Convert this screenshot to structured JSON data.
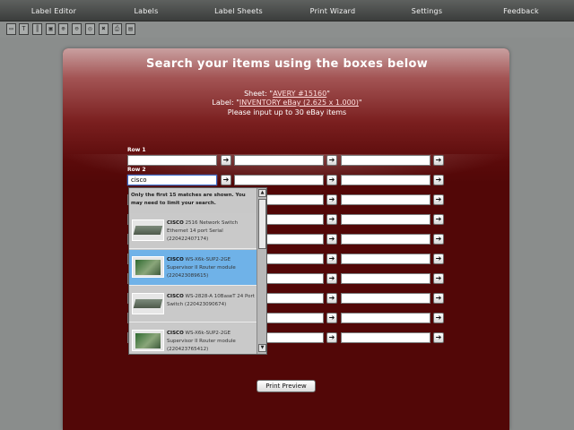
{
  "nav": [
    "Label Editor",
    "Labels",
    "Label Sheets",
    "Print Wizard",
    "Settings",
    "Feedback"
  ],
  "toolbar": [
    {
      "icon": "rect-icon",
      "glyph": "▭"
    },
    {
      "icon": "text-icon",
      "glyph": "T"
    },
    {
      "icon": "barcode-icon",
      "glyph": "║"
    },
    {
      "icon": "image-icon",
      "glyph": "▣"
    },
    {
      "icon": "zoom-in-icon",
      "glyph": "⊕"
    },
    {
      "icon": "zoom-out-icon",
      "glyph": "⊖"
    },
    {
      "icon": "zoom-fit-icon",
      "glyph": "◎"
    },
    {
      "icon": "delete-icon",
      "glyph": "✖"
    },
    {
      "icon": "print-icon",
      "glyph": "⎙"
    },
    {
      "icon": "save-icon",
      "glyph": "▤"
    }
  ],
  "page": {
    "heading": "Search your items using the boxes below",
    "sheet_prefix": "Sheet: \"",
    "sheet_link": "AVERY #15160",
    "sheet_suffix": "\"",
    "label_prefix": "Label: \"",
    "label_link": "INVENTORY eBay (2.625 x 1.000)",
    "label_suffix": "\"",
    "instruction": "Please input up to 30 eBay items"
  },
  "rows": {
    "row1_label": "Row 1",
    "row2_label": "Row 2",
    "active_value": "cisco",
    "go_glyph": "➔",
    "count": 10
  },
  "suggestions": {
    "note": "Only the first 15 matches are shown. You may need to limit your search.",
    "items": [
      {
        "brand": "CISCO",
        "desc": " 2516 Network Switch Ethernet 14 port Serial (220422407174)",
        "thumb": "switch",
        "selected": false
      },
      {
        "brand": "CISCO",
        "desc": " WS-X6k-SUP2-2GE Supervisor II Router module (220423089615)",
        "thumb": "board",
        "selected": true
      },
      {
        "brand": "CISCO",
        "desc": " WS-2828-A 10BaseT 24 Port Switch (220423090674)",
        "thumb": "switch",
        "selected": false
      },
      {
        "brand": "CISCO",
        "desc": " WS-X6k-SUP2-2GE Supervisor II Router module (220423765412)",
        "thumb": "board",
        "selected": false
      }
    ],
    "scroll_up": "▲",
    "scroll_down": "▼"
  },
  "actions": {
    "print_preview": "Print Preview"
  }
}
